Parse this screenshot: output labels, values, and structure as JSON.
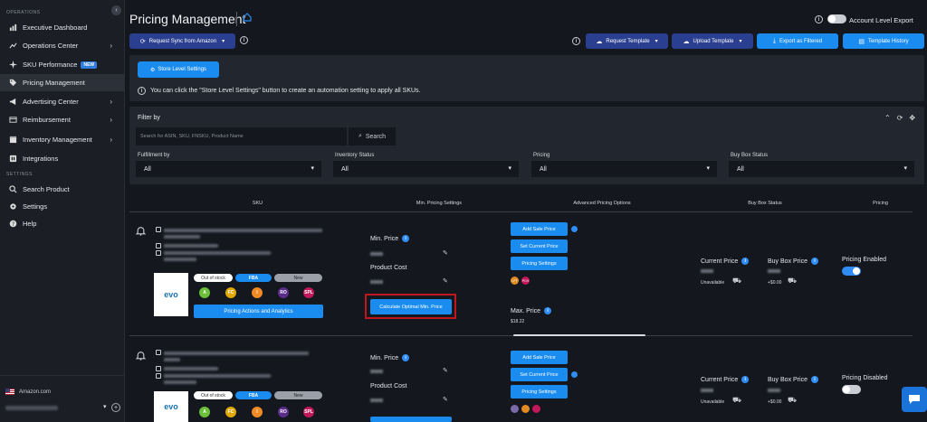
{
  "sidebar": {
    "section_operations": "OPERATIONS",
    "section_settings": "SETTINGS",
    "collapse_icon": "chevron-left-icon",
    "items": [
      {
        "label": "Executive Dashboard",
        "icon": "chart-icon"
      },
      {
        "label": "Operations Center",
        "icon": "graph-icon"
      },
      {
        "label": "SKU Performance",
        "icon": "sparkle-icon",
        "badge": "NEW"
      },
      {
        "label": "Pricing Management",
        "icon": "tag-icon"
      },
      {
        "label": "Advertising Center",
        "icon": "megaphone-icon"
      },
      {
        "label": "Reimbursement",
        "icon": "receipt-icon"
      },
      {
        "label": "Inventory Management",
        "icon": "box-icon"
      },
      {
        "label": "Integrations",
        "icon": "plug-icon"
      },
      {
        "label": "Search Product",
        "icon": "search-icon"
      },
      {
        "label": "Settings",
        "icon": "gear-icon"
      },
      {
        "label": "Help",
        "icon": "help-icon"
      }
    ],
    "store": "Amazon.com"
  },
  "header": {
    "title": "Pricing Management",
    "account_export_label": "Account Level Export",
    "request_sync_label": "Request Sync from Amazon",
    "request_template_label": "Request Template",
    "upload_template_label": "Upload Template",
    "export_filtered_label": "Export as Filtered",
    "template_history_label": "Template History"
  },
  "store_settings": {
    "button_label": "Store Level Settings",
    "message": "You can click the \"Store Level Settings\" button to create an automation setting to apply all SKUs."
  },
  "filter": {
    "title": "Filter by",
    "search_placeholder": "Search for ASIN, SKU, FNSKU, Product Name",
    "search_button": "Search",
    "fields": [
      {
        "label": "Fulfillment by",
        "value": "All"
      },
      {
        "label": "Inventory Status",
        "value": "All"
      },
      {
        "label": "Pricing",
        "value": "All"
      },
      {
        "label": "Buy Box Status",
        "value": "All"
      }
    ]
  },
  "table": {
    "headers": [
      "SKU",
      "Min. Pricing Settings",
      "Advanced Pricing Options",
      "Buy Box Status",
      "Pricing"
    ],
    "rows": [
      {
        "stock_tag": "Out of stock",
        "fba_tag": "FBA",
        "condition_tag": "New",
        "thumb_text": "evo",
        "badges": [
          "A",
          "FC",
          "I",
          "RO",
          "SPL"
        ],
        "actions_button": "Pricing Actions and Analytics",
        "min_price_label": "Min. Price",
        "product_cost_label": "Product Cost",
        "calc_button": "Calculate Optimal Min. Price",
        "add_sale_price": "Add Sale Price",
        "set_current_price": "Set Current Price",
        "pricing_settings": "Pricing Settings",
        "mini_badges": [
          "LPT",
          "PCH"
        ],
        "max_price_label": "Max. Price",
        "max_price_value": "$18.22",
        "current_price_label": "Current Price",
        "current_price_status": "Unavailable",
        "buybox_price_label": "Buy Box Price",
        "buybox_delta": "+$0.00",
        "pricing_status": "Pricing Enabled",
        "pricing_on": true
      },
      {
        "stock_tag": "Out of stock",
        "fba_tag": "FBA",
        "condition_tag": "New",
        "thumb_text": "evo",
        "badges": [
          "A",
          "FC",
          "I",
          "RO",
          "SPL"
        ],
        "min_price_label": "Min. Price",
        "product_cost_label": "Product Cost",
        "add_sale_price": "Add Sale Price",
        "set_current_price": "Set Current Price",
        "pricing_settings": "Pricing Settings",
        "current_price_label": "Current Price",
        "current_price_status": "Unavailable",
        "buybox_price_label": "Buy Box Price",
        "buybox_delta": "+$0.00",
        "pricing_status": "Pricing Disabled",
        "pricing_on": false
      }
    ]
  },
  "colors": {
    "accent": "#1a8cf0",
    "navy_button": "#2a3f8f",
    "highlight_border": "#c0161e",
    "background": "#14171d"
  }
}
